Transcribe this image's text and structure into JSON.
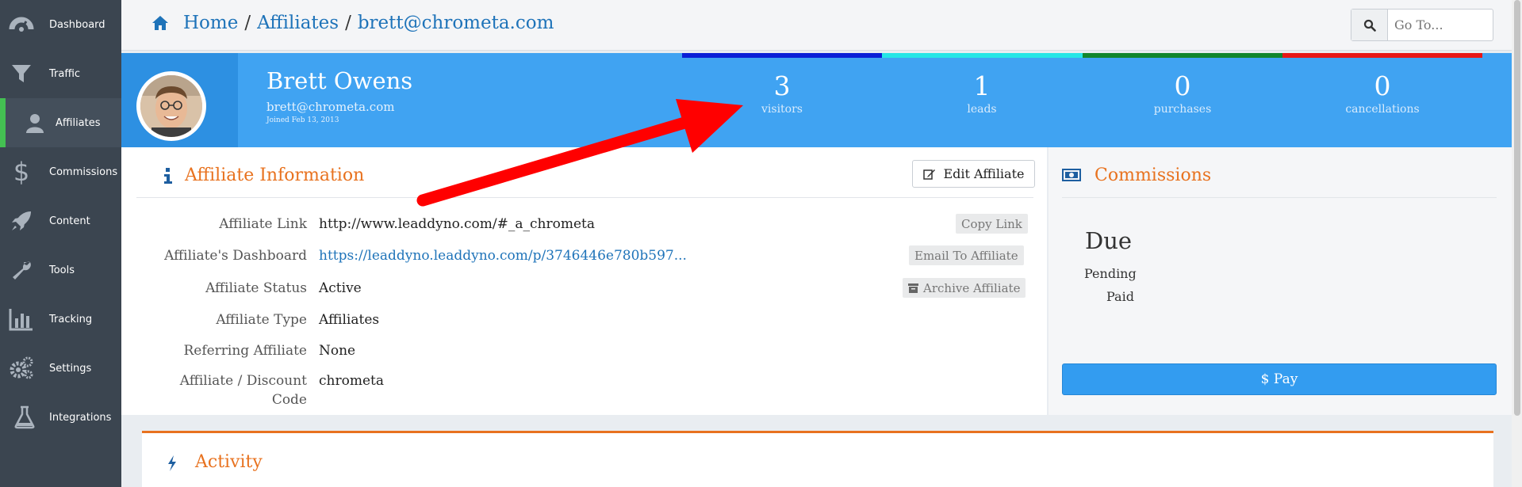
{
  "sidebar": {
    "items": [
      {
        "label": "Dashboard",
        "icon": "dashboard-icon"
      },
      {
        "label": "Traffic",
        "icon": "filter-icon"
      },
      {
        "label": "Affiliates",
        "icon": "user-icon",
        "active": true
      },
      {
        "label": "Commissions",
        "icon": "dollar-icon"
      },
      {
        "label": "Content",
        "icon": "rocket-icon"
      },
      {
        "label": "Tools",
        "icon": "wrench-icon"
      },
      {
        "label": "Tracking",
        "icon": "bar-chart-icon"
      },
      {
        "label": "Settings",
        "icon": "gears-icon"
      },
      {
        "label": "Integrations",
        "icon": "flask-icon"
      }
    ]
  },
  "breadcrumb": {
    "home": "Home",
    "section": "Affiliates",
    "current": "brett@chrometa.com",
    "separator": "/"
  },
  "goto": {
    "placeholder": "Go To..."
  },
  "profile": {
    "name": "Brett Owens",
    "email": "brett@chrometa.com",
    "joined": "Joined Feb 13, 2013"
  },
  "stats": [
    {
      "value": "3",
      "label": "visitors",
      "color": "#0a1fd6"
    },
    {
      "value": "1",
      "label": "leads",
      "color": "#25e6e6"
    },
    {
      "value": "0",
      "label": "purchases",
      "color": "#11862d"
    },
    {
      "value": "0",
      "label": "cancellations",
      "color": "#e81717"
    }
  ],
  "info": {
    "title": "Affiliate Information",
    "edit_button": "Edit Affiliate",
    "rows": [
      {
        "label": "Affiliate Link",
        "value": "http://www.leaddyno.com/#_a_chrometa"
      },
      {
        "label": "Affiliate's Dashboard",
        "value": "https://leaddyno.leaddyno.com/p/3746446e780b597..."
      },
      {
        "label": "Affiliate Status",
        "value": "Active"
      },
      {
        "label": "Affiliate Type",
        "value": "Affiliates"
      },
      {
        "label": "Referring Affiliate",
        "value": "None"
      },
      {
        "label": "Affiliate / Discount",
        "label2": "Code",
        "value": "chrometa"
      }
    ],
    "copy_link": "Copy Link",
    "email_affiliate": "Email To Affiliate",
    "archive_affiliate": "Archive Affiliate"
  },
  "commissions": {
    "title": "Commissions",
    "due": "Due",
    "pending": "Pending",
    "paid": "Paid",
    "pay_button": "$ Pay"
  },
  "activity": {
    "title": "Activity"
  },
  "colors": {
    "accent_orange": "#e8721f",
    "link_blue": "#1e73b9",
    "banner_blue": "#40a3f2",
    "sidebar": "#3b4550",
    "active_green": "#44c052",
    "annotation_red": "#ff0000"
  }
}
